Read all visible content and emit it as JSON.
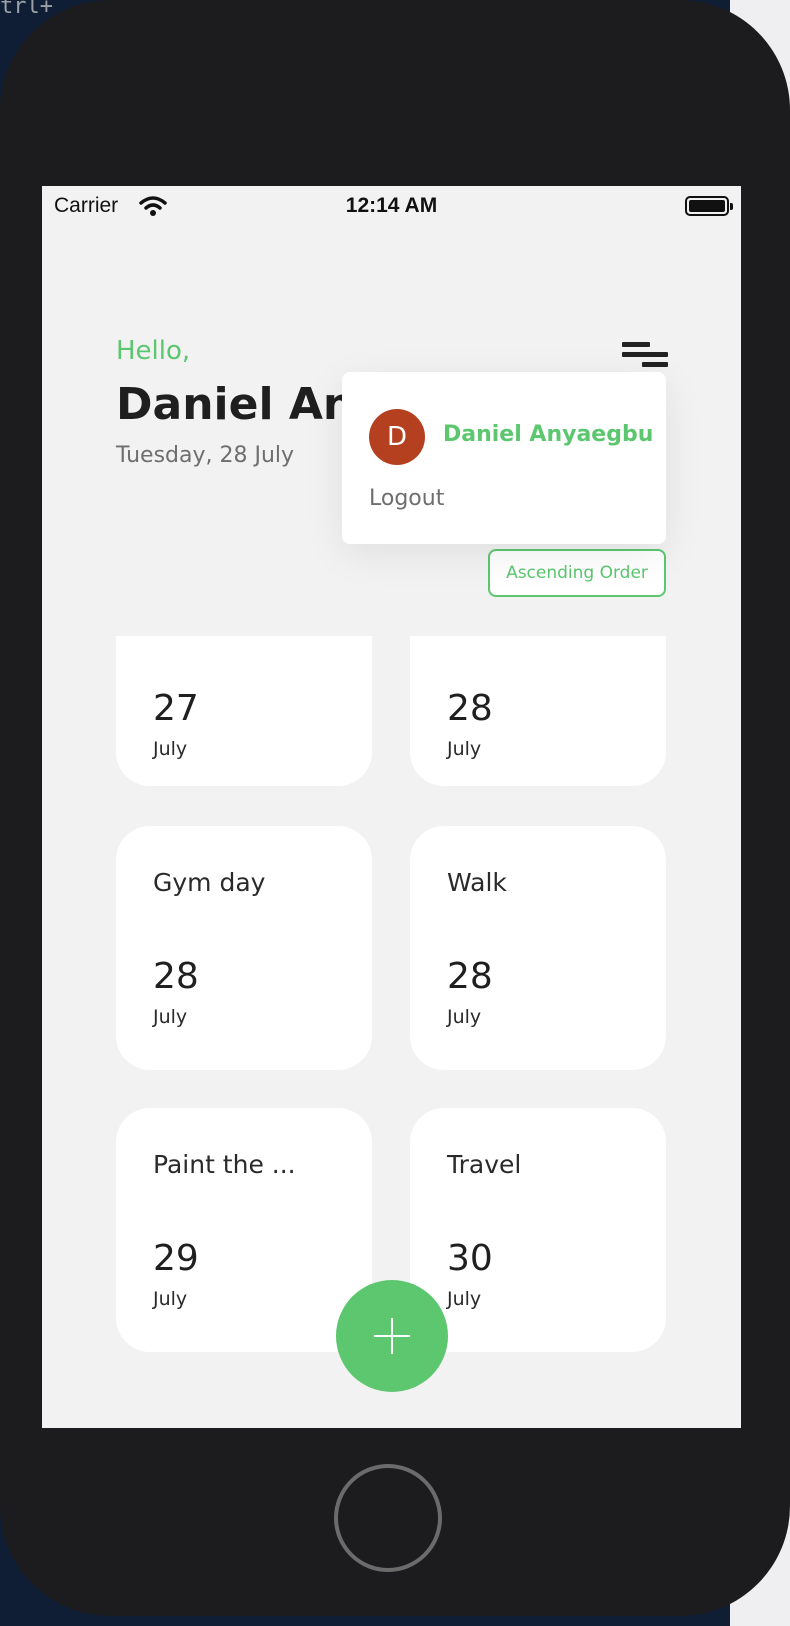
{
  "desktop": {
    "code_text": "trl+"
  },
  "status_bar": {
    "carrier": "Carrier",
    "time": "12:14 AM"
  },
  "header": {
    "greeting": "Hello,",
    "name": "Daniel Anyaegbu",
    "date": "Tuesday, 28 July"
  },
  "popup": {
    "avatar_letter": "D",
    "user_name": "Daniel Anyaegbu",
    "logout_label": "Logout"
  },
  "sort_button": {
    "label": "Ascending Order"
  },
  "cards": [
    {
      "title": "",
      "day": "27",
      "month": "July"
    },
    {
      "title": "",
      "day": "28",
      "month": "July"
    },
    {
      "title": "Gym day",
      "day": "28",
      "month": "July"
    },
    {
      "title": "Walk",
      "day": "28",
      "month": "July"
    },
    {
      "title": "Paint the ...",
      "day": "29",
      "month": "July"
    },
    {
      "title": "Travel",
      "day": "30",
      "month": "July"
    }
  ],
  "colors": {
    "accent": "#5cc76f",
    "avatar": "#b54020"
  },
  "icons": {
    "menu": "menu-icon",
    "wifi": "wifi-icon",
    "battery": "battery-icon",
    "add": "plus-icon"
  }
}
